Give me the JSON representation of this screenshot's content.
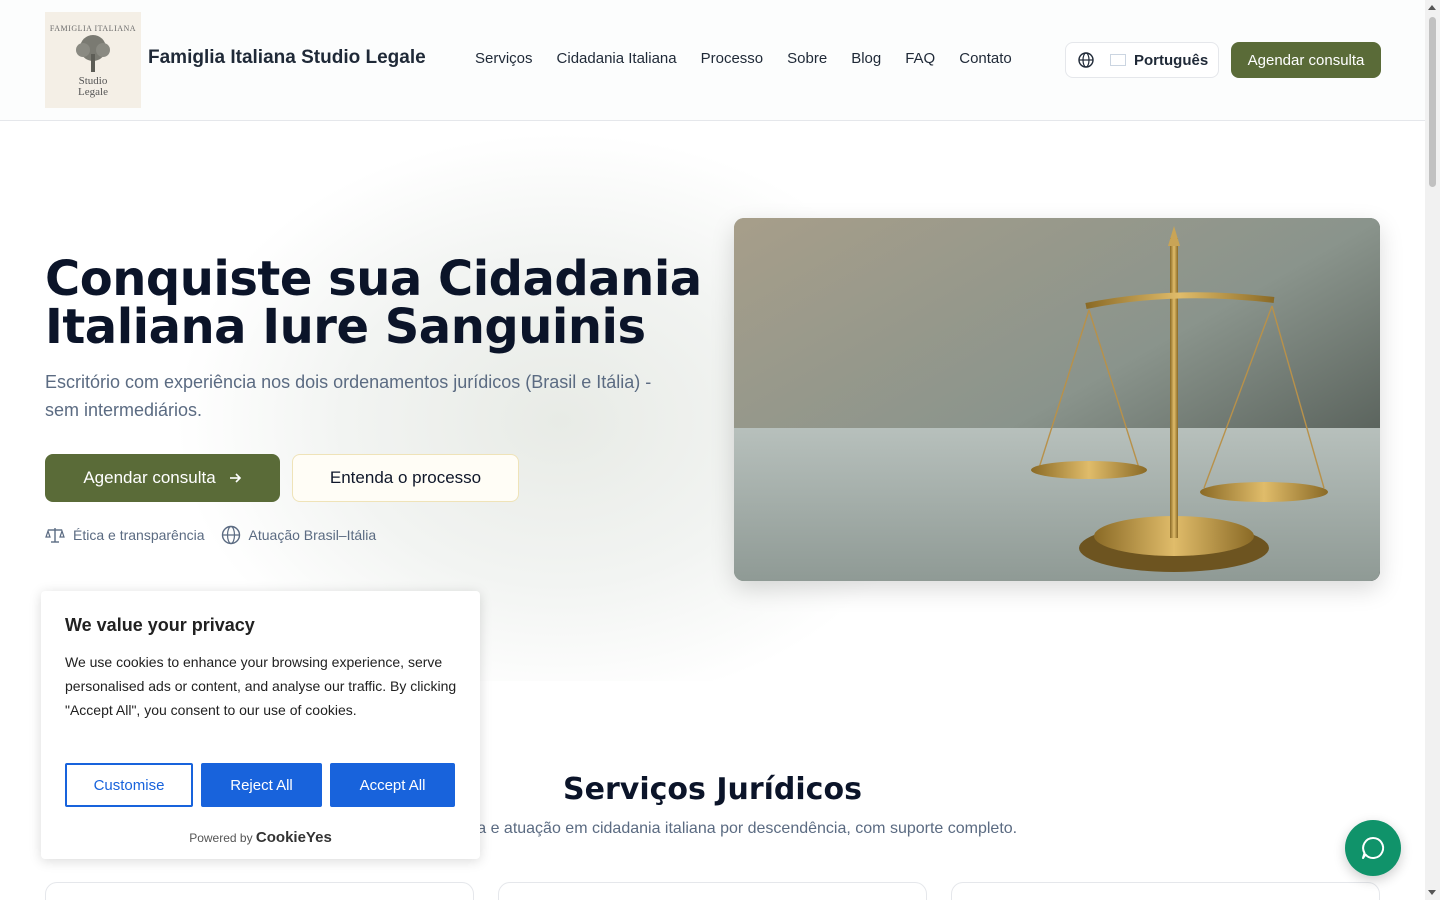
{
  "header": {
    "logo": {
      "top_text": "FAMIGLIA ITALIANA",
      "sub_line1": "Studio",
      "sub_line2": "Legale"
    },
    "brand": "Famiglia Italiana Studio Legale",
    "nav": [
      "Serviços",
      "Cidadania Italiana",
      "Processo",
      "Sobre",
      "Blog",
      "FAQ",
      "Contato"
    ],
    "language": "Português",
    "cta": "Agendar consulta"
  },
  "hero": {
    "title": "Conquiste sua Cidadania Italiana Iure Sanguinis",
    "subtitle": "Escritório com experiência nos dois ordenamentos jurídicos (Brasil e Itália) - sem intermediários.",
    "primary_button": "Agendar consulta",
    "secondary_button": "Entenda o processo",
    "trust": [
      "Ética e transparência",
      "Atuação Brasil–Itália"
    ]
  },
  "services": {
    "title": "Serviços Jurídicos",
    "subtitle": "Assessoria e atuação em cidadania italiana por descendência, com suporte completo."
  },
  "cookie": {
    "title": "We value your privacy",
    "text": "We use cookies to enhance your browsing experience, serve personalised ads or content, and analyse our traffic. By clicking \"Accept All\", you consent to our use of cookies.",
    "customise": "Customise",
    "reject": "Reject All",
    "accept": "Accept All",
    "powered_by": "Powered by",
    "powered_brand": "CookieYes"
  },
  "colors": {
    "primary": "#5a6b38",
    "cookie_blue": "#1863dc",
    "chat": "#10936a"
  }
}
